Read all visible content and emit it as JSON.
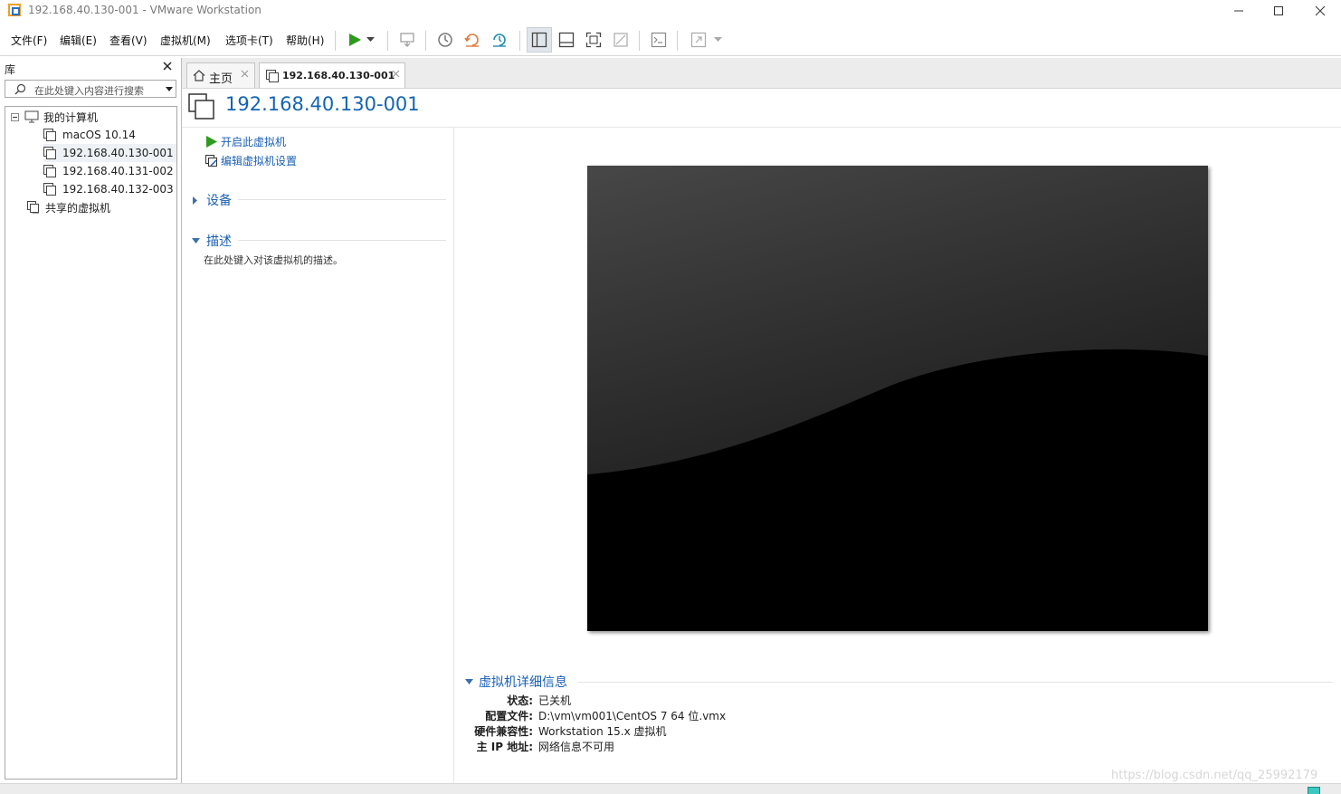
{
  "window": {
    "title": "192.168.40.130-001 - VMware Workstation"
  },
  "menu": [
    "文件(F)",
    "编辑(E)",
    "查看(V)",
    "虚拟机(M)",
    "选项卡(T)",
    "帮助(H)"
  ],
  "library": {
    "title": "库",
    "search_placeholder": "在此处键入内容进行搜索",
    "root_label": "我的计算机",
    "items": [
      "macOS 10.14",
      "192.168.40.130-001",
      "192.168.40.131-002",
      "192.168.40.132-003"
    ],
    "selected_item": "192.168.40.130-001",
    "shared_label": "共享的虚拟机"
  },
  "tabs": [
    {
      "label": "主页",
      "active": false
    },
    {
      "label": "192.168.40.130-001",
      "active": true
    }
  ],
  "vm": {
    "title": "192.168.40.130-001",
    "actions": [
      "开启此虚拟机",
      "编辑虚拟机设置"
    ],
    "sections": {
      "devices": "设备",
      "description": "描述",
      "description_text": "在此处键入对该虚拟机的描述。"
    },
    "details": {
      "title": "虚拟机详细信息",
      "rows": [
        {
          "key": "状态:",
          "value": "已关机"
        },
        {
          "key": "配置文件:",
          "value": "D:\\vm\\vm001\\CentOS 7 64 位.vmx"
        },
        {
          "key": "硬件兼容性:",
          "value": "Workstation 15.x 虚拟机"
        },
        {
          "key": "主 IP 地址:",
          "value": "网络信息不可用"
        }
      ]
    }
  },
  "watermark": "https://blog.csdn.net/qq_25992179",
  "colors": {
    "accent": "#1464b4",
    "play_green": "#2e9a1e",
    "status_indicator": "#3cc8c0"
  }
}
